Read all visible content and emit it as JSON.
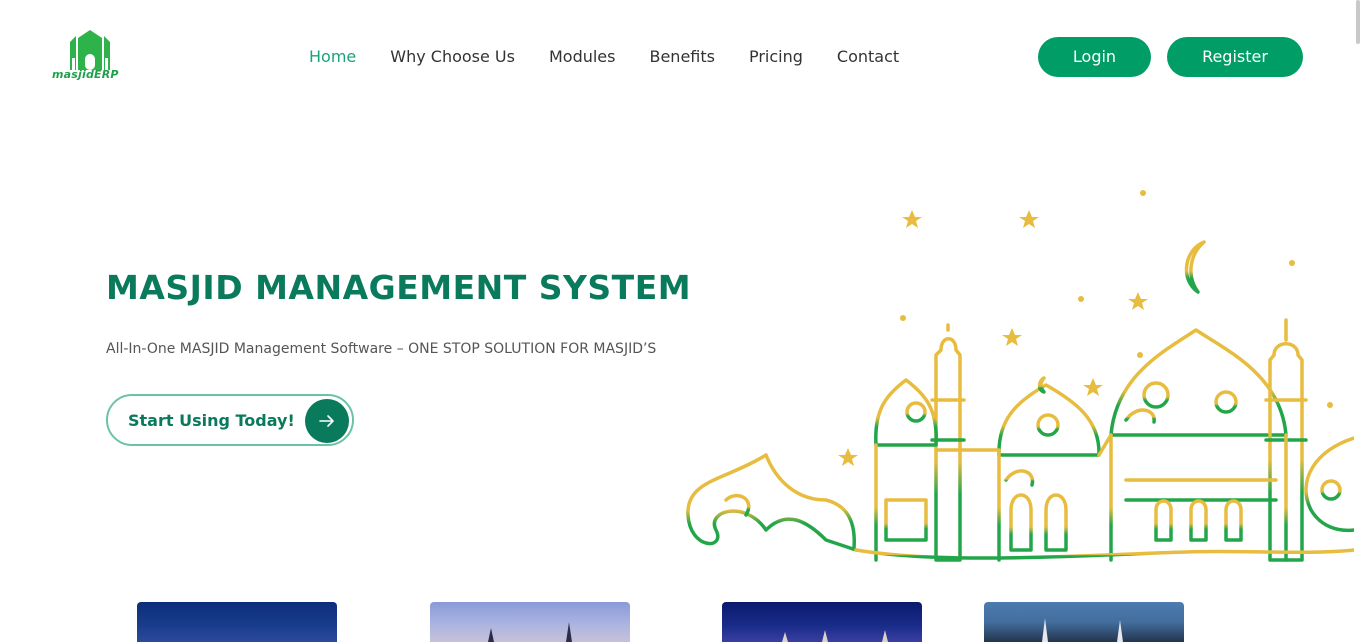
{
  "logo": {
    "word": "masjidERP"
  },
  "nav": [
    "Home",
    "Why Choose Us",
    "Modules",
    "Benefits",
    "Pricing",
    "Contact"
  ],
  "nav_active": 0,
  "auth": {
    "login": "Login",
    "register": "Register"
  },
  "hero": {
    "title": "MASJID MANAGEMENT SYSTEM",
    "subtitle": "All-In-One MASJID Management Software – ONE STOP SOLUTION FOR MASJID’S",
    "cta": "Start Using Today!"
  },
  "colors": {
    "brand": "#009e66",
    "title": "#0a7a5c",
    "active_nav": "#1aa37a",
    "art_green": "#23a64a",
    "art_gold": "#e7bc3f"
  },
  "icons": {
    "cta": "arrow-right-icon"
  }
}
